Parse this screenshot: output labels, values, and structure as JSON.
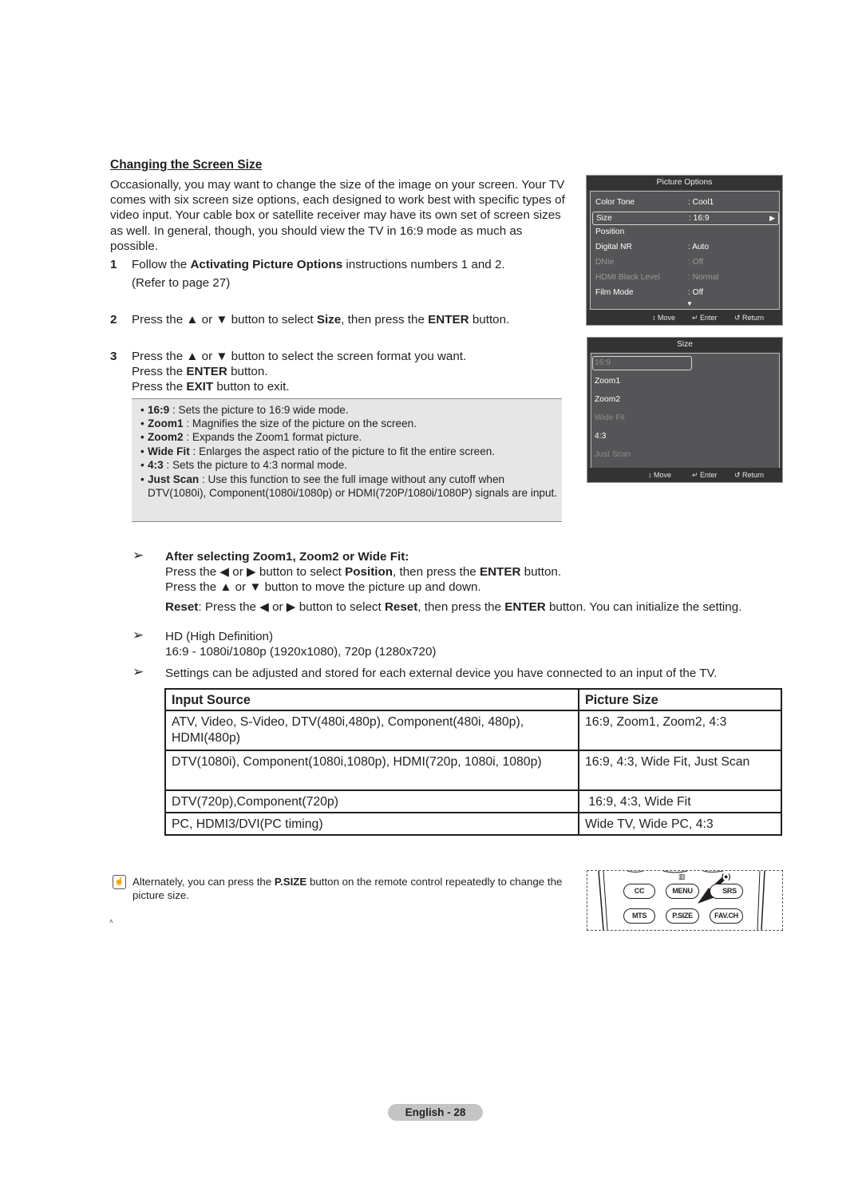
{
  "section": {
    "title": "Changing the Screen Size",
    "intro": "Occasionally, you may want to change the size of the image on your screen. Your TV comes with six screen size options, each designed to work best with specific types of video input. Your cable box or satellite receiver may have its own set of screen sizes as well. In general, though, you should view the TV in 16:9 mode as much as possible."
  },
  "steps": [
    {
      "num": "1",
      "pre": "Follow the ",
      "bold": "Activating Picture Options",
      "post": " instructions numbers 1 and 2.",
      "line2": "(Refer to page 27)"
    },
    {
      "num": "2",
      "pre": "Press the ▲ or ▼ button to select ",
      "bold": "Size",
      "mid": ", then press the ",
      "bold2": "ENTER",
      "post": " button."
    },
    {
      "num": "3",
      "line1": "Press the ▲ or ▼ button to select the screen format you want.",
      "line2_pre": "Press the ",
      "line2_bold": "ENTER",
      "line2_post": " button.",
      "line3_pre": "Press the ",
      "line3_bold": "EXIT",
      "line3_post": " button to exit."
    }
  ],
  "descriptions": [
    {
      "term": "16:9",
      "text": " : Sets the picture to 16:9 wide mode."
    },
    {
      "term": "Zoom1",
      "text": " : Magnifies the size of the picture on the screen."
    },
    {
      "term": "Zoom2",
      "text": " : Expands the Zoom1 format picture."
    },
    {
      "term": "Wide Fit",
      "text": " : Enlarges the aspect ratio of the picture to fit the entire screen."
    },
    {
      "term": "4:3",
      "text": " : Sets the picture to 4:3 normal mode."
    },
    {
      "term": "Just Scan",
      "text": " : Use this function to see the full image without any cutoff when DTV(1080i), Component(1080i/1080p) or HDMI(720P/1080i/1080P) signals are input."
    }
  ],
  "picture_options_menu": {
    "title": "Picture Options",
    "items": [
      {
        "label": "Color Tone",
        "value": ": Cool1"
      },
      {
        "label": "Size",
        "value": ": 16:9",
        "arrow": "▶"
      },
      {
        "label": "Position",
        "value": ""
      },
      {
        "label": "Digital NR",
        "value": ": Auto"
      },
      {
        "label": "DNIe",
        "value": ": Off"
      },
      {
        "label": "HDMI Black Level",
        "value": ": Normal"
      },
      {
        "label": "Film Mode",
        "value": ": Off"
      }
    ],
    "more_indicator": "▼",
    "footer": {
      "move": "↕ Move",
      "enter": "↵ Enter",
      "return": "↺ Return"
    }
  },
  "size_menu": {
    "title": "Size",
    "items": [
      "16:9",
      "Zoom1",
      "Zoom2",
      "Wide Fit",
      "4:3",
      "Just Scan"
    ],
    "footer": {
      "move": "↕ Move",
      "enter": "↵ Enter",
      "return": "↺ Return"
    }
  },
  "notes": {
    "arrow": "➢",
    "n1_title": "After selecting Zoom1, Zoom2 or Wide Fit:",
    "n1_l1_a": "Press the ◀ or ▶ button to select ",
    "n1_l1_b": "Position",
    "n1_l1_c": ", then press the ",
    "n1_l1_d": "ENTER",
    "n1_l1_e": " button.",
    "n1_l2": "Press the ▲ or ▼ button to move the picture up and down.",
    "n1_l3_a": "Reset",
    "n1_l3_b": ": Press the ◀ or ▶ button to select ",
    "n1_l3_c": "Reset",
    "n1_l3_d": ", then press the ",
    "n1_l3_e": "ENTER",
    "n1_l3_f": " button. You can initialize the setting.",
    "n2_l1": "HD (High Definition)",
    "n2_l2": "16:9 - 1080i/1080p (1920x1080), 720p (1280x720)",
    "n3": "Settings can be adjusted and stored for each external device you have connected to an input of the TV."
  },
  "table": {
    "headers": [
      "Input Source",
      "Picture Size"
    ],
    "rows": [
      [
        "ATV, Video, S-Video, DTV(480i,480p), Component(480i, 480p), HDMI(480p)",
        "16:9, Zoom1, Zoom2, 4:3"
      ],
      [
        "DTV(1080i), Component(1080i,1080p), HDMI(720p, 1080i, 1080p)",
        "16:9, 4:3, Wide Fit, Just Scan"
      ],
      [
        "DTV(720p),Component(720p)",
        " 16:9, 4:3, Wide Fit"
      ],
      [
        "PC, HDMI3/DVI(PC timing)",
        "Wide TV, Wide PC, 4:3"
      ]
    ]
  },
  "tip": {
    "icon": "☝",
    "pre": "Alternately, you can press the ",
    "bold": "P.SIZE",
    "post": " button on the remote control repeatedly to change the picture size."
  },
  "remote": {
    "buttons_row1": [
      "CC",
      "MENU",
      "SRS"
    ],
    "buttons_row2": [
      "MTS",
      "P.SIZE",
      "FAV.CH"
    ],
    "menu_glyph": "▥",
    "srs_glyph": "(●)"
  },
  "footer": {
    "page_label": "English - 28"
  }
}
